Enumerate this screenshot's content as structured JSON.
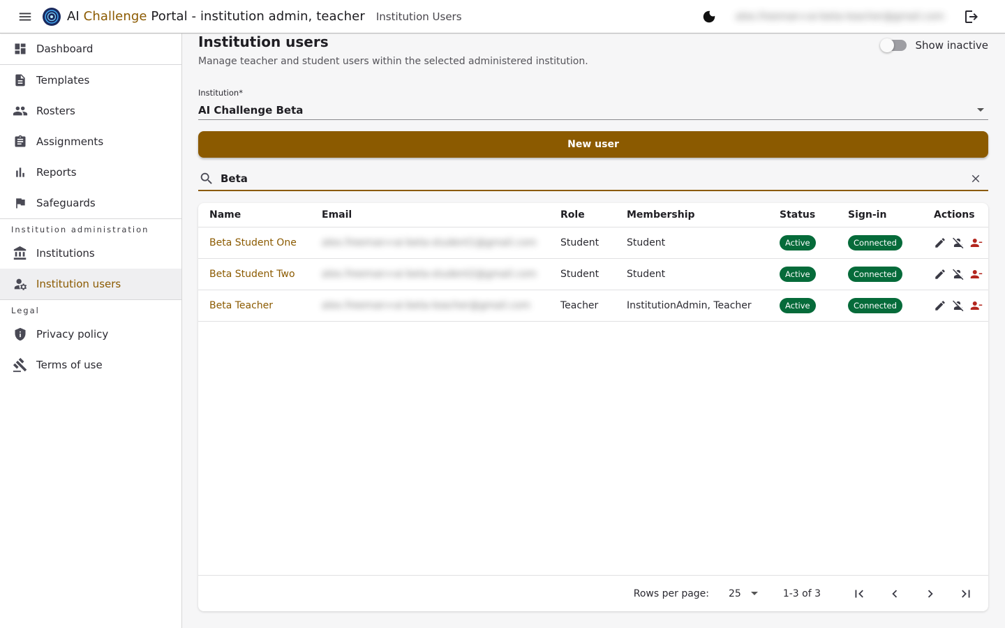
{
  "header": {
    "title_prefix": "AI",
    "title_accent": "Challenge",
    "title_suffix": "Portal - institution admin, teacher",
    "breadcrumb": "Institution Users",
    "user_email": "alex.freeman+ai-beta-teacher@gmail.com",
    "icons": [
      "menu-icon",
      "logo-icon",
      "dark-mode-icon",
      "logout-icon"
    ]
  },
  "sidebar": {
    "items": [
      {
        "label": "Dashboard",
        "icon": "dashboard-icon"
      },
      {
        "label": "Templates",
        "icon": "document-icon"
      },
      {
        "label": "Rosters",
        "icon": "people-icon"
      },
      {
        "label": "Assignments",
        "icon": "clipboard-icon"
      },
      {
        "label": "Reports",
        "icon": "bar-chart-icon"
      },
      {
        "label": "Safeguards",
        "icon": "flag-icon"
      }
    ],
    "admin_section_title": "Institution administration",
    "admin_items": [
      {
        "label": "Institutions",
        "icon": "institution-icon"
      },
      {
        "label": "Institution users",
        "icon": "manage-accounts-icon",
        "active": true
      }
    ],
    "legal_section_title": "Legal",
    "legal_items": [
      {
        "label": "Privacy policy",
        "icon": "shield-icon"
      },
      {
        "label": "Terms of use",
        "icon": "gavel-icon"
      }
    ]
  },
  "main": {
    "title": "Institution users",
    "subtitle": "Manage teacher and student users within the selected administered institution.",
    "show_inactive_label": "Show inactive",
    "show_inactive": false,
    "institution_label": "Institution*",
    "institution_value": "AI Challenge Beta",
    "new_user_label": "New user",
    "search_value": "Beta",
    "table": {
      "columns": [
        "Name",
        "Email",
        "Role",
        "Membership",
        "Status",
        "Sign-in",
        "Actions"
      ],
      "rows": [
        {
          "name": "Beta Student One",
          "email": "alex.freeman+ai-beta-student1@gmail.com",
          "role": "Student",
          "membership": "Student",
          "status": "Active",
          "signin": "Connected"
        },
        {
          "name": "Beta Student Two",
          "email": "alex.freeman+ai-beta-student2@gmail.com",
          "role": "Student",
          "membership": "Student",
          "status": "Active",
          "signin": "Connected"
        },
        {
          "name": "Beta Teacher",
          "email": "alex.freeman+ai-beta-teacher@gmail.com",
          "role": "Teacher",
          "membership": "InstitutionAdmin, Teacher",
          "status": "Active",
          "signin": "Connected"
        }
      ]
    },
    "pagination": {
      "rows_per_page_label": "Rows per page:",
      "rows_per_page": "25",
      "range": "1-3 of 3"
    }
  },
  "colors": {
    "accent": "#8b5a00",
    "chip_green": "#066b3a",
    "delete_red": "#b3261e"
  }
}
